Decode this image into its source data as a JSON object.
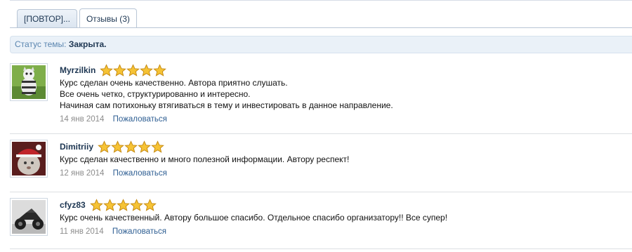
{
  "tabs": [
    {
      "label": "[ПОВТОР]...",
      "active": false
    },
    {
      "label": "Отзывы (3)",
      "active": true
    }
  ],
  "topic_status": {
    "label": "Статус темы:",
    "value": "Закрыта."
  },
  "reviews": [
    {
      "author": "Myrzilkin",
      "rating": 5,
      "lines": [
        "Курс сделан очень качественно. Автора приятно слушать.",
        "Все очень четко, структурированно и интересно.",
        "Начиная сам потихоньку втягиваться в тему и инвестировать в данное направление."
      ],
      "date": "14 янв 2014",
      "report_label": "Пожаловаться"
    },
    {
      "author": "Dimitriiy",
      "rating": 5,
      "lines": [
        "Курс сделан качественно и много полезной информации. Автору респект!"
      ],
      "date": "12 янв 2014",
      "report_label": "Пожаловаться"
    },
    {
      "author": "cfyz83",
      "rating": 5,
      "lines": [
        "Курс очень качественный. Автору большое спасибо. Отдельное спасибо организатору!! Все супер!"
      ],
      "date": "11 янв 2014",
      "report_label": "Пожаловаться"
    }
  ],
  "colors": {
    "link": "#2f5f93",
    "author": "#1d3652",
    "star_fill": "#f6c335",
    "status_bg": "#eaf1f8"
  }
}
